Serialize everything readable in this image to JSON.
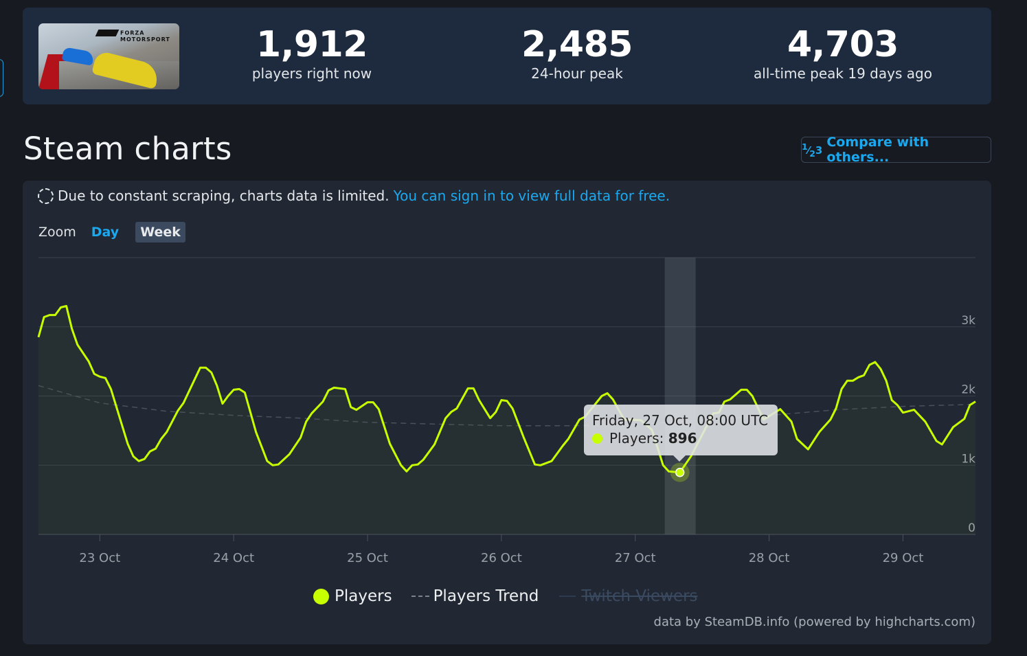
{
  "stats": {
    "game_logo": "FORZA MOTORSPORT",
    "items": [
      {
        "value": "1,912",
        "label": "players right now"
      },
      {
        "value": "2,485",
        "label": "24-hour peak"
      },
      {
        "value": "4,703",
        "label": "all-time peak 19 days ago"
      }
    ]
  },
  "section": {
    "title": "Steam charts",
    "compare_icon": "1-2-3-icon",
    "compare_label": "Compare with others..."
  },
  "notice": {
    "icon": "dashed-circle-icon",
    "text": "Due to constant scraping, charts data is limited.",
    "link": "You can sign in to view full data for free."
  },
  "zoom": {
    "label": "Zoom",
    "options": [
      "Day",
      "Week"
    ],
    "selected": "Week"
  },
  "tooltip": {
    "date": "Friday, 27 Oct, 08:00 UTC",
    "series": "Players: ",
    "value": "896"
  },
  "legend": {
    "players": "Players",
    "trend": "Players Trend",
    "twitch": "Twitch Viewers"
  },
  "credit": "data by SteamDB.info (powered by highcharts.com)",
  "colors": {
    "players": "#c7ff00",
    "accent": "#1ba8ee",
    "trend": "#7a828c"
  },
  "chart_data": {
    "type": "line",
    "ylabels": [
      "0",
      "1k",
      "2k",
      "3k"
    ],
    "yticks": [
      0,
      1000,
      2000,
      3000
    ],
    "ylim": [
      0,
      4000
    ],
    "xlabels": [
      "23 Oct",
      "24 Oct",
      "25 Oct",
      "26 Oct",
      "27 Oct",
      "28 Oct",
      "29 Oct"
    ],
    "xticks": [
      "2023-10-23T00:00",
      "2023-10-24T00:00",
      "2023-10-25T00:00",
      "2023-10-26T00:00",
      "2023-10-27T00:00",
      "2023-10-28T00:00",
      "2023-10-29T00:00"
    ],
    "xlim": [
      "2023-10-22T13:00",
      "2023-10-29T13:00"
    ],
    "grid": true,
    "legend_position": "bottom",
    "highlight": {
      "x": "2023-10-27T08:00",
      "y": 896
    },
    "series": [
      {
        "name": "Players",
        "color": "#c7ff00",
        "points": [
          [
            "2023-10-22T13:00",
            2850
          ],
          [
            "2023-10-22T14:00",
            3140
          ],
          [
            "2023-10-22T15:00",
            3170
          ],
          [
            "2023-10-22T16:00",
            3170
          ],
          [
            "2023-10-22T17:00",
            3280
          ],
          [
            "2023-10-22T18:00",
            3300
          ],
          [
            "2023-10-22T19:00",
            2970
          ],
          [
            "2023-10-22T20:00",
            2740
          ],
          [
            "2023-10-22T22:00",
            2500
          ],
          [
            "2023-10-22T23:00",
            2320
          ],
          [
            "2023-10-23T00:00",
            2280
          ],
          [
            "2023-10-23T01:00",
            2260
          ],
          [
            "2023-10-23T02:00",
            2100
          ],
          [
            "2023-10-23T05:00",
            1310
          ],
          [
            "2023-10-23T06:00",
            1130
          ],
          [
            "2023-10-23T07:00",
            1060
          ],
          [
            "2023-10-23T08:00",
            1090
          ],
          [
            "2023-10-23T09:00",
            1200
          ],
          [
            "2023-10-23T10:00",
            1240
          ],
          [
            "2023-10-23T11:00",
            1380
          ],
          [
            "2023-10-23T12:00",
            1480
          ],
          [
            "2023-10-23T14:00",
            1790
          ],
          [
            "2023-10-23T15:00",
            1900
          ],
          [
            "2023-10-23T18:00",
            2410
          ],
          [
            "2023-10-23T19:00",
            2410
          ],
          [
            "2023-10-23T20:00",
            2340
          ],
          [
            "2023-10-23T21:00",
            2150
          ],
          [
            "2023-10-23T22:00",
            1890
          ],
          [
            "2023-10-23T23:00",
            2000
          ],
          [
            "2023-10-24T00:00",
            2090
          ],
          [
            "2023-10-24T01:00",
            2100
          ],
          [
            "2023-10-24T02:00",
            2050
          ],
          [
            "2023-10-24T04:00",
            1480
          ],
          [
            "2023-10-24T06:00",
            1060
          ],
          [
            "2023-10-24T07:00",
            1000
          ],
          [
            "2023-10-24T08:00",
            1010
          ],
          [
            "2023-10-24T10:00",
            1160
          ],
          [
            "2023-10-24T12:00",
            1400
          ],
          [
            "2023-10-24T13:00",
            1630
          ],
          [
            "2023-10-24T14:00",
            1750
          ],
          [
            "2023-10-24T16:00",
            1920
          ],
          [
            "2023-10-24T17:00",
            2080
          ],
          [
            "2023-10-24T18:00",
            2120
          ],
          [
            "2023-10-24T20:00",
            2100
          ],
          [
            "2023-10-24T21:00",
            1840
          ],
          [
            "2023-10-24T22:00",
            1800
          ],
          [
            "2023-10-25T00:00",
            1910
          ],
          [
            "2023-10-25T01:00",
            1910
          ],
          [
            "2023-10-25T02:00",
            1810
          ],
          [
            "2023-10-25T04:00",
            1310
          ],
          [
            "2023-10-25T06:00",
            1000
          ],
          [
            "2023-10-25T07:00",
            910
          ],
          [
            "2023-10-25T08:00",
            1000
          ],
          [
            "2023-10-25T09:00",
            1010
          ],
          [
            "2023-10-25T10:00",
            1080
          ],
          [
            "2023-10-25T12:00",
            1300
          ],
          [
            "2023-10-25T14:00",
            1680
          ],
          [
            "2023-10-25T15:00",
            1770
          ],
          [
            "2023-10-25T16:00",
            1820
          ],
          [
            "2023-10-25T18:00",
            2110
          ],
          [
            "2023-10-25T19:00",
            2110
          ],
          [
            "2023-10-25T20:00",
            1940
          ],
          [
            "2023-10-25T22:00",
            1680
          ],
          [
            "2023-10-25T23:00",
            1770
          ],
          [
            "2023-10-26T00:00",
            1940
          ],
          [
            "2023-10-26T01:00",
            1930
          ],
          [
            "2023-10-26T02:00",
            1820
          ],
          [
            "2023-10-26T04:00",
            1400
          ],
          [
            "2023-10-26T06:00",
            1010
          ],
          [
            "2023-10-26T07:00",
            1000
          ],
          [
            "2023-10-26T09:00",
            1060
          ],
          [
            "2023-10-26T11:00",
            1280
          ],
          [
            "2023-10-26T12:00",
            1380
          ],
          [
            "2023-10-26T14:00",
            1660
          ],
          [
            "2023-10-26T15:00",
            1700
          ],
          [
            "2023-10-26T18:00",
            2000
          ],
          [
            "2023-10-26T19:00",
            2040
          ],
          [
            "2023-10-26T20:00",
            1950
          ],
          [
            "2023-10-26T22:00",
            1660
          ],
          [
            "2023-10-27T01:00",
            1650
          ],
          [
            "2023-10-27T03:00",
            1510
          ],
          [
            "2023-10-27T05:00",
            1000
          ],
          [
            "2023-10-27T06:00",
            910
          ],
          [
            "2023-10-27T08:00",
            896
          ],
          [
            "2023-10-27T10:00",
            1130
          ],
          [
            "2023-10-27T14:00",
            1750
          ],
          [
            "2023-10-27T15:00",
            1760
          ],
          [
            "2023-10-27T16:00",
            1920
          ],
          [
            "2023-10-27T17:00",
            1950
          ],
          [
            "2023-10-27T19:00",
            2090
          ],
          [
            "2023-10-27T20:00",
            2090
          ],
          [
            "2023-10-27T21:00",
            2000
          ],
          [
            "2023-10-27T23:00",
            1660
          ],
          [
            "2023-10-28T02:00",
            1810
          ],
          [
            "2023-10-28T04:00",
            1630
          ],
          [
            "2023-10-28T05:00",
            1380
          ],
          [
            "2023-10-28T07:00",
            1230
          ],
          [
            "2023-10-28T09:00",
            1480
          ],
          [
            "2023-10-28T11:00",
            1660
          ],
          [
            "2023-10-28T12:00",
            1820
          ],
          [
            "2023-10-28T13:00",
            2100
          ],
          [
            "2023-10-28T14:00",
            2220
          ],
          [
            "2023-10-28T15:00",
            2220
          ],
          [
            "2023-10-28T16:00",
            2270
          ],
          [
            "2023-10-28T17:00",
            2300
          ],
          [
            "2023-10-28T18:00",
            2450
          ],
          [
            "2023-10-28T19:00",
            2490
          ],
          [
            "2023-10-28T20:00",
            2390
          ],
          [
            "2023-10-28T21:00",
            2220
          ],
          [
            "2023-10-28T22:00",
            1940
          ],
          [
            "2023-10-28T23:00",
            1870
          ],
          [
            "2023-10-29T00:00",
            1760
          ],
          [
            "2023-10-29T02:00",
            1800
          ],
          [
            "2023-10-29T04:00",
            1630
          ],
          [
            "2023-10-29T06:00",
            1350
          ],
          [
            "2023-10-29T07:00",
            1300
          ],
          [
            "2023-10-29T09:00",
            1550
          ],
          [
            "2023-10-29T11:00",
            1670
          ],
          [
            "2023-10-29T12:00",
            1870
          ],
          [
            "2023-10-29T13:00",
            1920
          ]
        ]
      },
      {
        "name": "Players Trend",
        "color": "#7a828c",
        "dashed": true,
        "points": [
          [
            "2023-10-22T13:00",
            2150
          ],
          [
            "2023-10-23T00:00",
            1900
          ],
          [
            "2023-10-23T12:00",
            1780
          ],
          [
            "2023-10-24T00:00",
            1720
          ],
          [
            "2023-10-24T12:00",
            1680
          ],
          [
            "2023-10-25T00:00",
            1620
          ],
          [
            "2023-10-26T00:00",
            1570
          ],
          [
            "2023-10-26T12:00",
            1570
          ],
          [
            "2023-10-27T00:00",
            1590
          ],
          [
            "2023-10-27T12:00",
            1650
          ],
          [
            "2023-10-28T00:00",
            1720
          ],
          [
            "2023-10-28T12:00",
            1800
          ],
          [
            "2023-10-29T00:00",
            1850
          ],
          [
            "2023-10-29T13:00",
            1880
          ]
        ]
      },
      {
        "name": "Twitch Viewers",
        "hidden": true,
        "points": []
      }
    ]
  }
}
